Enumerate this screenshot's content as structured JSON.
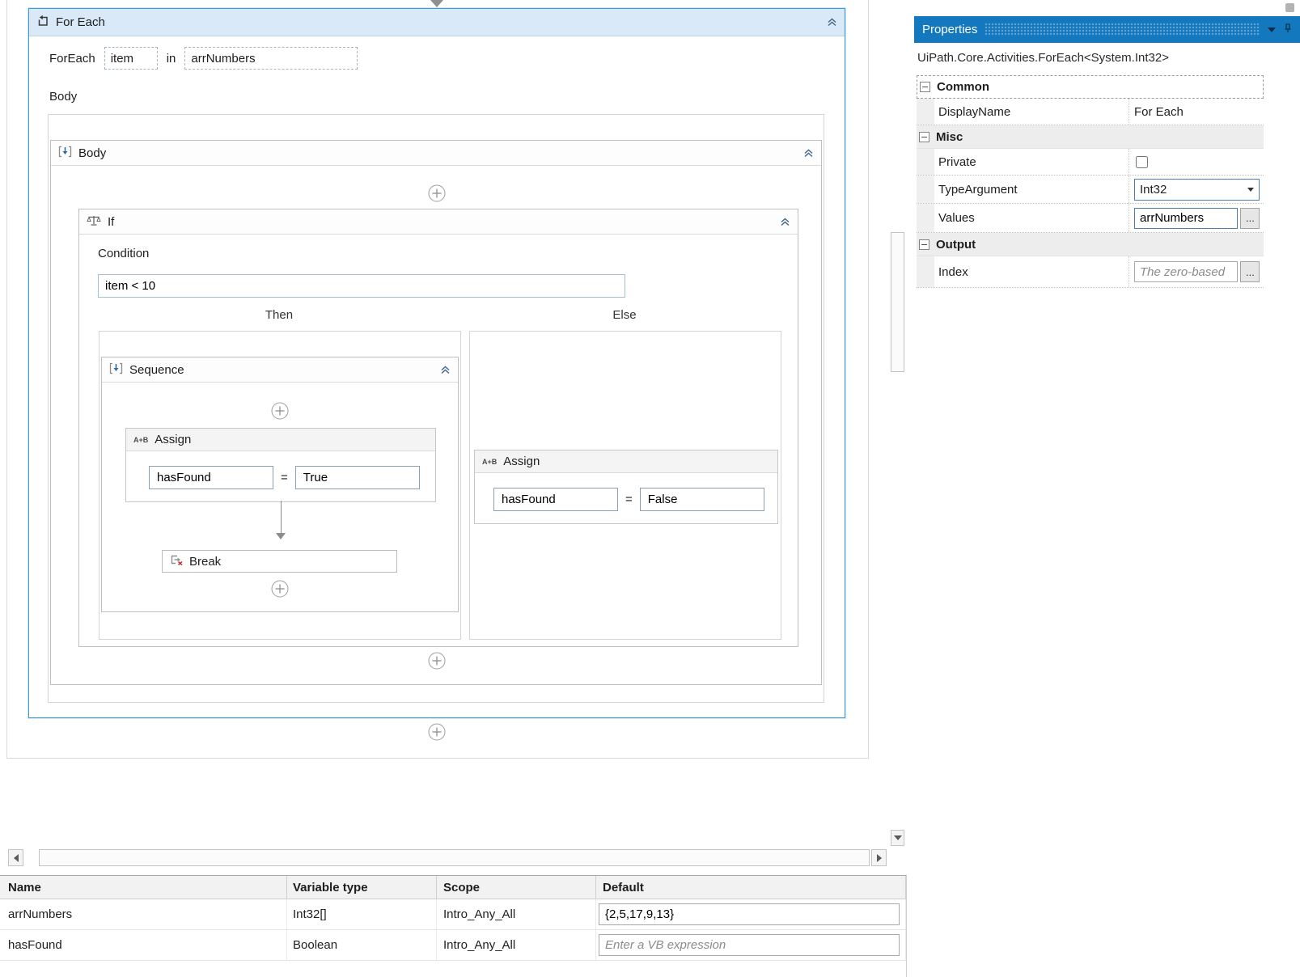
{
  "canvas": {
    "for_each": {
      "title": "For Each",
      "foreach_label": "ForEach",
      "item": "item",
      "in_label": "in",
      "collection": "arrNumbers",
      "body_label": "Body"
    },
    "body_sequence": {
      "title": "Body"
    },
    "if_activity": {
      "title": "If",
      "condition_label": "Condition",
      "condition": "item < 10",
      "then_label": "Then",
      "else_label": "Else"
    },
    "then_sequence": {
      "title": "Sequence"
    },
    "assign_title": "Assign",
    "assign_icon_text": "A+B",
    "then_assign": {
      "to": "hasFound",
      "eq": "=",
      "value": "True"
    },
    "else_assign": {
      "to": "hasFound",
      "eq": "=",
      "value": "False"
    },
    "break_title": "Break"
  },
  "properties": {
    "title": "Properties",
    "activity_type": "UiPath.Core.Activities.ForEach<System.Int32>",
    "sections": {
      "common": "Common",
      "misc": "Misc",
      "output": "Output"
    },
    "rows": {
      "display_name": {
        "label": "DisplayName",
        "value": "For Each"
      },
      "private": {
        "label": "Private"
      },
      "type_argument": {
        "label": "TypeArgument",
        "value": "Int32"
      },
      "values": {
        "label": "Values",
        "value": "arrNumbers"
      },
      "index": {
        "label": "Index",
        "placeholder": "The zero-based"
      }
    },
    "ellipsis": "..."
  },
  "variables": {
    "columns": [
      "Name",
      "Variable type",
      "Scope",
      "Default"
    ],
    "rows": [
      {
        "name": "arrNumbers",
        "type": "Int32[]",
        "scope": "Intro_Any_All",
        "default": "{2,5,17,9,13}"
      },
      {
        "name": "hasFound",
        "type": "Boolean",
        "scope": "Intro_Any_All",
        "default_placeholder": "Enter a VB expression"
      }
    ]
  },
  "colors": {
    "selection_blue": "#3d9ad8",
    "header_blue": "#1378bd",
    "foreach_header_bg": "#d9e9f7"
  }
}
